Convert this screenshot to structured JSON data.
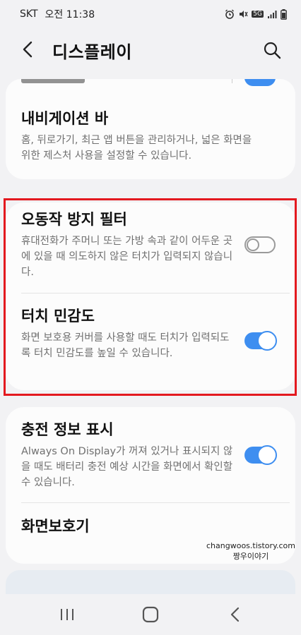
{
  "status_bar": {
    "carrier": "SKT",
    "time": "오전 11:38",
    "network_badge": "5G"
  },
  "app_bar": {
    "title": "디스플레이",
    "icons": [
      "back-arrow-icon",
      "search-icon"
    ]
  },
  "cards": [
    {
      "items": [
        {
          "title": "내비게이션 바",
          "description": "홈, 뒤로가기, 최근 앱 버튼을 관리하거나, 넓은 화면을 위한 제스처 사용을 설정할 수 있습니다."
        }
      ]
    },
    {
      "items": [
        {
          "title": "오동작 방지 필터",
          "description": "휴대전화가 주머니 또는 가방 속과 같이 어두운 곳에 있을 때 의도하지 않은 터치가 입력되지 않습니다.",
          "toggle_on": false
        },
        {
          "title": "터치 민감도",
          "description": "화면 보호용 커버를 사용할 때도 터치가 입력되도록 터치 민감도를 높일 수 있습니다.",
          "toggle_on": true
        }
      ]
    },
    {
      "items": [
        {
          "title": "충전 정보 표시",
          "description": "Always On Display가 꺼져 있거나 표시되지 않을 때도 배터리 충전 예상 시간을 화면에서 확인할 수 있습니다.",
          "toggle_on": true
        },
        {
          "title": "화면보호기"
        }
      ]
    }
  ],
  "watermark": {
    "line1": "changwoos.tistory.com",
    "line2": "짱우이야기"
  },
  "nav_bar": {
    "icons": [
      "recent-apps-icon",
      "home-icon",
      "back-icon"
    ]
  },
  "colors": {
    "accent": "#3e8ef0",
    "highlight": "#e3191f",
    "background": "#f2f2f4",
    "card": "#fcfcfc"
  }
}
